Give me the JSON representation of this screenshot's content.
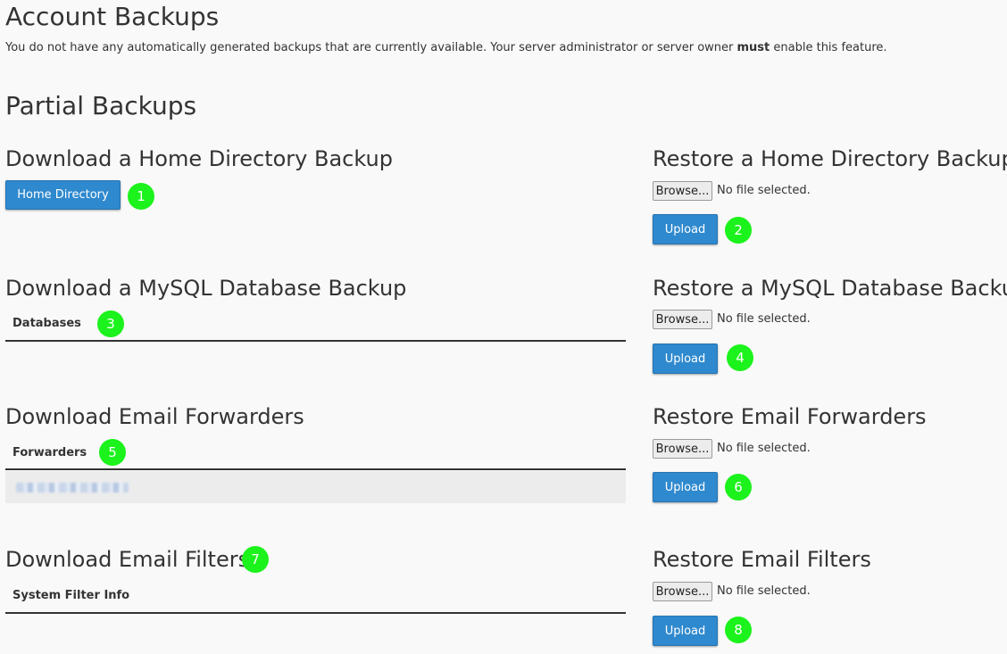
{
  "account_backups": {
    "title": "Account Backups",
    "notice_pre": "You do not have any automatically generated backups that are currently available. Your server administrator or server owner ",
    "notice_bold": "must",
    "notice_post": " enable this feature."
  },
  "partial_backups": {
    "title": "Partial Backups"
  },
  "download_home": {
    "title": "Download a Home Directory Backup",
    "button_label": "Home Directory",
    "badge": "1"
  },
  "restore_home": {
    "title": "Restore a Home Directory Backup",
    "browse_label": "Browse...",
    "file_status": "No file selected.",
    "upload_label": "Upload",
    "badge": "2"
  },
  "download_mysql": {
    "title": "Download a MySQL Database Backup",
    "table_header": "Databases",
    "badge": "3"
  },
  "restore_mysql": {
    "title": "Restore a MySQL Database Backup",
    "browse_label": "Browse...",
    "file_status": "No file selected.",
    "upload_label": "Upload",
    "badge": "4"
  },
  "download_forwarders": {
    "title": "Download Email Forwarders",
    "table_header": "Forwarders",
    "badge": "5"
  },
  "restore_forwarders": {
    "title": "Restore Email Forwarders",
    "browse_label": "Browse...",
    "file_status": "No file selected.",
    "upload_label": "Upload",
    "badge": "6"
  },
  "download_filters": {
    "title": "Download Email Filters",
    "table_header": "System Filter Info",
    "badge": "7"
  },
  "restore_filters": {
    "title": "Restore Email Filters",
    "browse_label": "Browse...",
    "file_status": "No file selected.",
    "upload_label": "Upload",
    "badge": "8"
  },
  "colors": {
    "primary_button": "#2f89ce",
    "badge_green": "#1cf21c",
    "background": "#f9f9f9"
  }
}
